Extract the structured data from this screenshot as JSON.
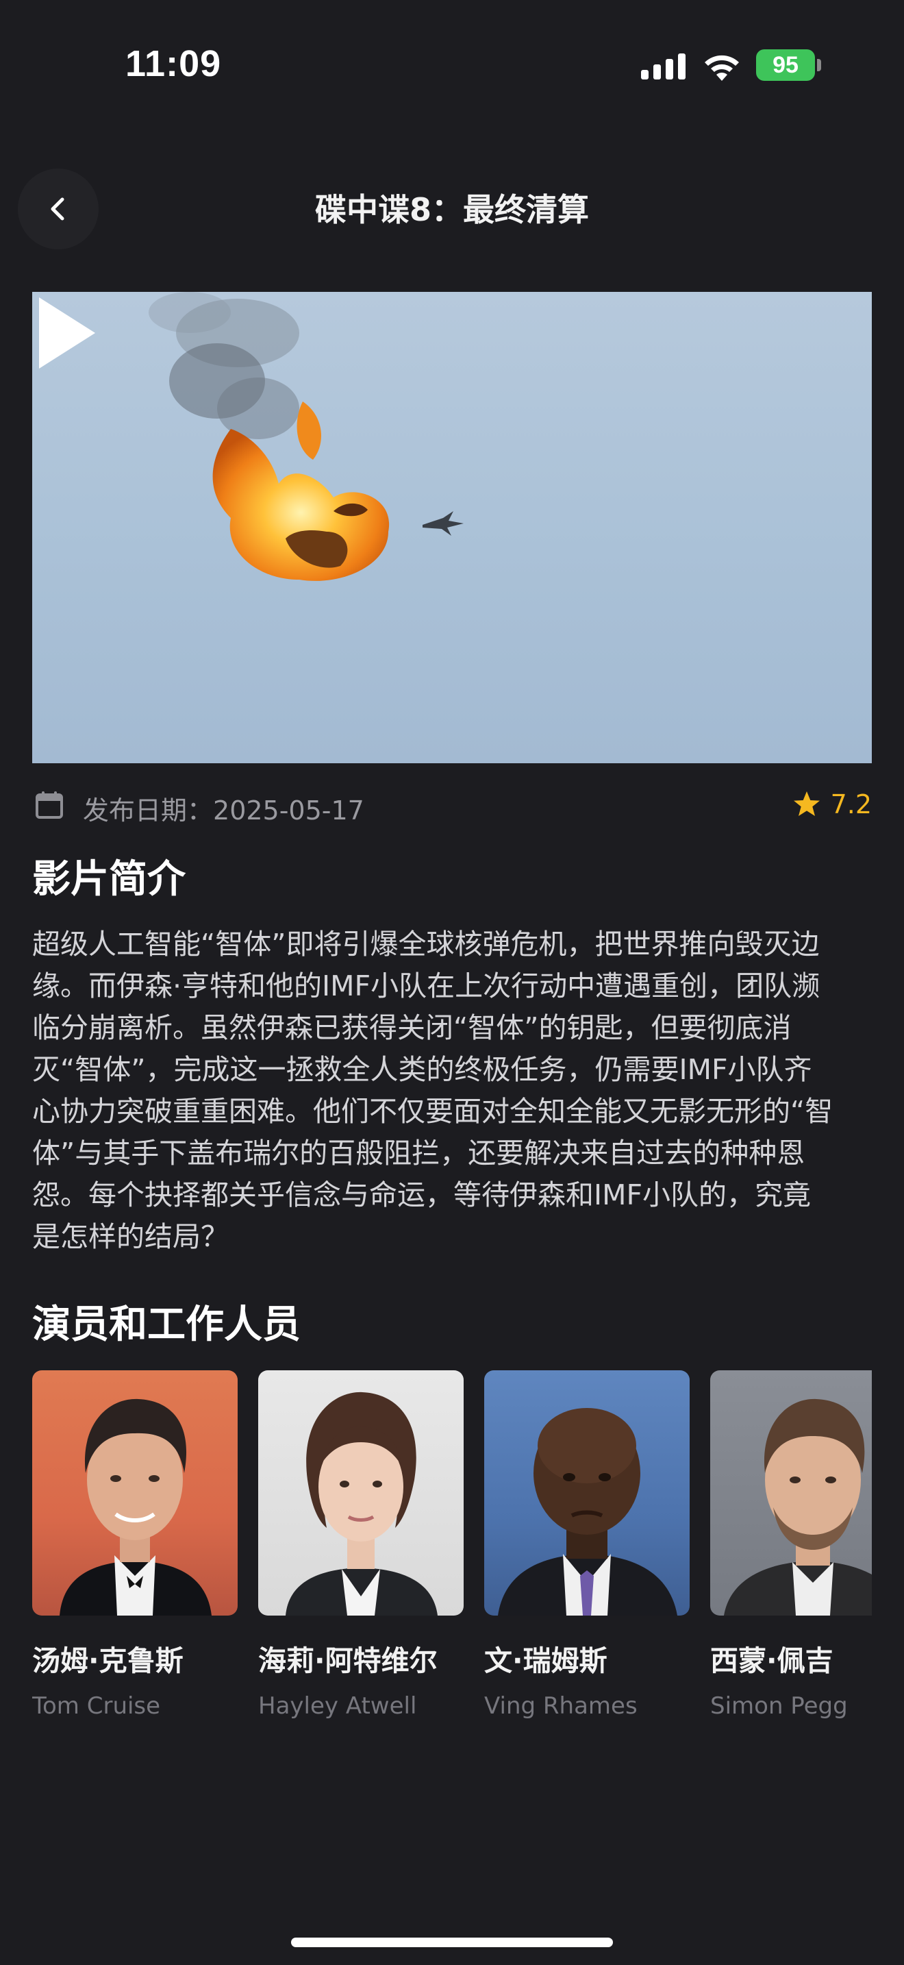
{
  "status_bar": {
    "time": "11:09",
    "battery": "95",
    "battery_color": "#3ec45a"
  },
  "header": {
    "title": "碟中谍8：最终清算",
    "back_icon": "chevron-left-icon"
  },
  "video": {
    "play_icon": "play-icon"
  },
  "meta": {
    "release_label": "发布日期：",
    "release_date": "2025-05-17",
    "rating": "7.2",
    "rating_color": "#f5b820"
  },
  "synopsis": {
    "title": "影片简介",
    "lines": [
      "超级人工智能“智体”即将引爆全球核弹危机，把世界推向毁灭边",
      "缘。而伊森·亨特和他的IMF小队在上次行动中遭遇重创，团队濒",
      "临分崩离析。虽然伊森已获得关闭“智体”的钥匙，但要彻底消",
      "灭“智体”，完成这一拯救全人类的终极任务，仍需要IMF小队齐",
      "心协力突破重重困难。他们不仅要面对全知全能又无影无形的“智",
      "体”与其手下盖布瑞尔的百般阻拦，还要解决来自过去的种种恩",
      "怨。每个抉择都关乎信念与命运，等待伊森和IMF小队的，究竟",
      "是怎样的结局？"
    ]
  },
  "cast": {
    "title": "演员和工作人员",
    "members": [
      {
        "name": "汤姆·克鲁斯",
        "name_en": "Tom Cruise"
      },
      {
        "name": "海莉·阿特维尔",
        "name_en": "Hayley Atwell"
      },
      {
        "name": "文·瑞姆斯",
        "name_en": "Ving Rhames"
      },
      {
        "name": "西蒙·佩吉",
        "name_en": "Simon Pegg"
      }
    ]
  }
}
